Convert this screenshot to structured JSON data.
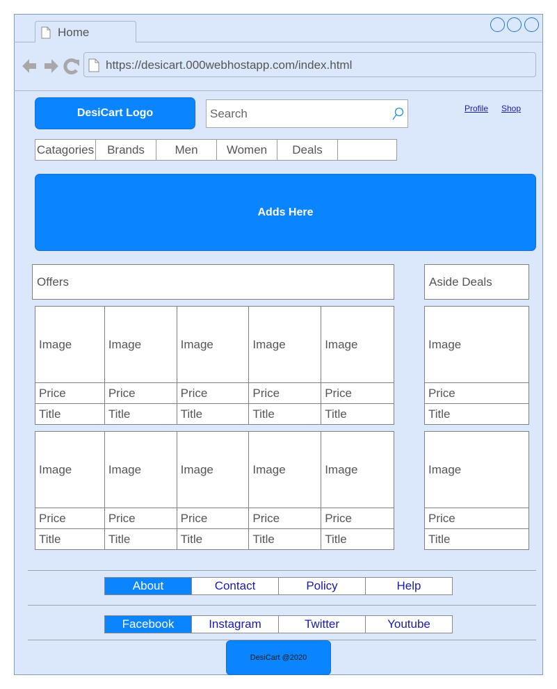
{
  "browser": {
    "tab_title": "Home",
    "url": "https://desicart.000webhostapp.com/index.html"
  },
  "header": {
    "logo": "DesiCart Logo",
    "search_placeholder": "Search",
    "links": [
      "Profile",
      "Shop"
    ]
  },
  "categories": [
    "Catagories",
    "Brands",
    "Men",
    "Women",
    "Deals",
    ""
  ],
  "ads": "Adds Here",
  "offers": {
    "title": "Offers",
    "rows": [
      [
        {
          "image": "Image",
          "price": "Price",
          "title": "Title"
        },
        {
          "image": "Image",
          "price": "Price",
          "title": "Title"
        },
        {
          "image": "Image",
          "price": "Price",
          "title": "Title"
        },
        {
          "image": "Image",
          "price": "Price",
          "title": "Title"
        },
        {
          "image": "Image",
          "price": "Price",
          "title": "Title"
        }
      ],
      [
        {
          "image": "Image",
          "price": "Price",
          "title": "Title"
        },
        {
          "image": "Image",
          "price": "Price",
          "title": "Title"
        },
        {
          "image": "Image",
          "price": "Price",
          "title": "Title"
        },
        {
          "image": "Image",
          "price": "Price",
          "title": "Title"
        },
        {
          "image": "Image",
          "price": "Price",
          "title": "Title"
        }
      ]
    ]
  },
  "aside": {
    "title": "Aside Deals",
    "items": [
      {
        "image": "Image",
        "price": "Price",
        "title": "Title"
      },
      {
        "image": "Image",
        "price": "Price",
        "title": "Title"
      }
    ]
  },
  "footer": {
    "links": [
      "About",
      "Contact",
      "Policy",
      "Help"
    ],
    "social": [
      "Facebook",
      "Instagram",
      "Twitter",
      "Youtube"
    ],
    "copyright": "DesiCart @2020"
  },
  "colors": {
    "accent": "#0a84ff",
    "window_bg": "#dbe8fb",
    "link": "#1a1aa8"
  }
}
